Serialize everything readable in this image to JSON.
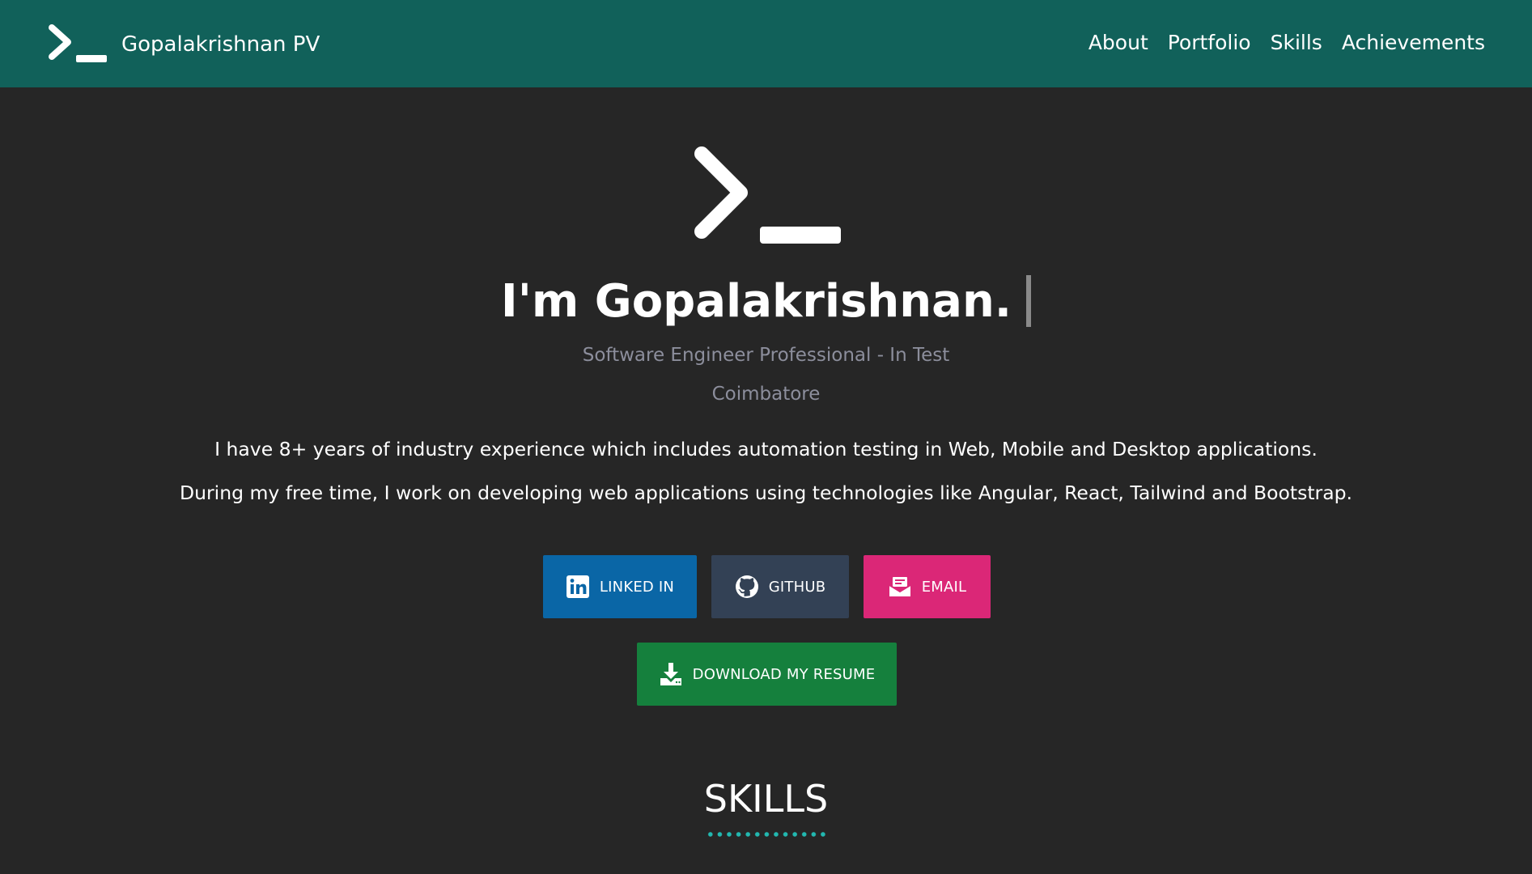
{
  "navbar": {
    "brand_name": "Gopalakrishnan PV",
    "logo_icon": "terminal-prompt-icon",
    "links": [
      "About",
      "Portfolio",
      "Skills",
      "Achievements"
    ],
    "background": "#11615a"
  },
  "hero": {
    "logo_icon": "terminal-prompt-icon",
    "headline": "I'm Gopalakrishnan.",
    "subtitle": "Software Engineer Professional - In Test",
    "location": "Coimbatore",
    "bio": [
      "I have 8+ years of industry experience which includes automation testing in Web, Mobile and Desktop applications.",
      "During my free time, I work on developing web applications using technologies like Angular, React, Tailwind and Bootstrap."
    ]
  },
  "buttons": {
    "linkedin": {
      "label": "LINKED IN",
      "icon": "linkedin-icon",
      "color": "#0a66a6"
    },
    "github": {
      "label": "GITHUB",
      "icon": "github-icon",
      "color": "#334155"
    },
    "email": {
      "label": "EMAIL",
      "icon": "email-icon",
      "color": "#db2777"
    },
    "resume": {
      "label": "DOWNLOAD MY RESUME",
      "icon": "download-icon",
      "color": "#15803d"
    }
  },
  "skills": {
    "title": "SKILLS",
    "underline_color": "#22b8b0"
  },
  "page_background": "#262626"
}
